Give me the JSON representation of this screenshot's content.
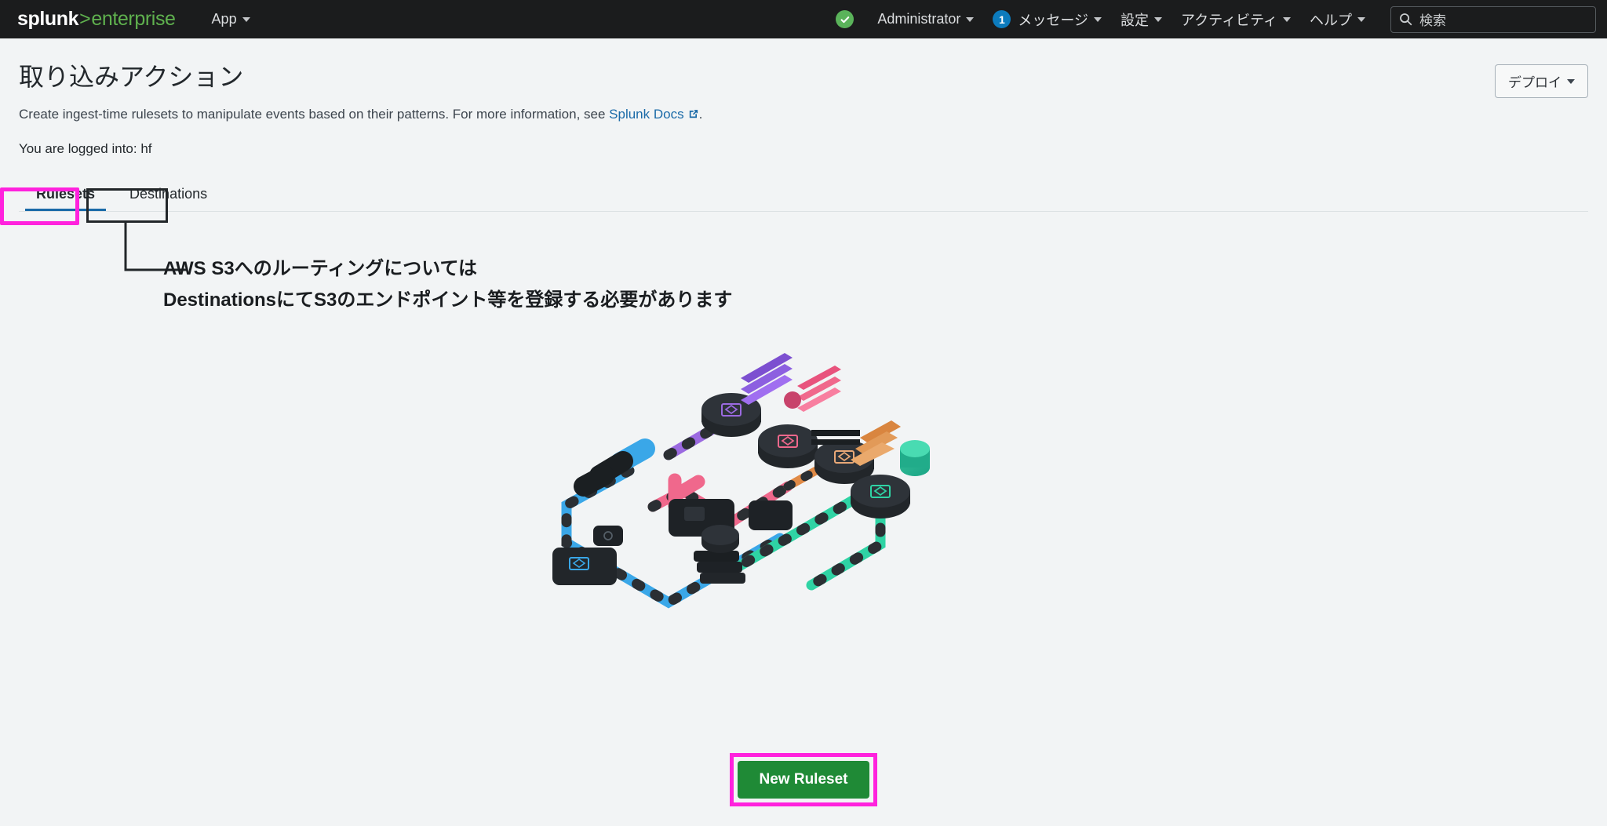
{
  "appbar": {
    "brand": {
      "primary": "splunk",
      "separator": ">",
      "secondary": "enterprise"
    },
    "app_menu": {
      "label": "App",
      "icon": "chevron-down-icon"
    },
    "health_icon": "health-check-ok-icon",
    "account": {
      "label": "Administrator",
      "icon": "chevron-down-icon"
    },
    "messages": {
      "count": "1",
      "label": "メッセージ",
      "icon": "chevron-down-icon"
    },
    "settings": {
      "label": "設定",
      "icon": "chevron-down-icon"
    },
    "activity": {
      "label": "アクティビティ",
      "icon": "chevron-down-icon"
    },
    "help": {
      "label": "ヘルプ",
      "icon": "chevron-down-icon"
    },
    "search": {
      "placeholder": "検索",
      "icon": "search-icon"
    },
    "colors": {
      "background": "#1b1c1d",
      "brand_green": "#5fb14e",
      "badge_blue": "#0c7bbd",
      "health_green": "#5ab35a"
    }
  },
  "page": {
    "title": "取り込みアクション",
    "description_before_link": "Create ingest-time rulesets to manipulate events based on their patterns. For more information, see ",
    "description_link": "Splunk Docs",
    "description_link_icon": "external-link-icon",
    "description_after_link": ".",
    "logged_into": "You are logged into: hf",
    "deploy_button": {
      "label": "デプロイ",
      "icon": "chevron-down-icon"
    }
  },
  "tabs": [
    {
      "label": "Rulesets",
      "active": true
    },
    {
      "label": "Destinations",
      "active": false
    }
  ],
  "annotations": {
    "highlight_color": "#ff22dd",
    "callout_line1": "AWS S3へのルーティングについては",
    "callout_line2": "DestinationsにてS3のエンドポイント等を登録する必要があります"
  },
  "empty_state": {
    "illustration": "isometric-data-pipeline-illustration",
    "new_ruleset_button": {
      "label": "New Ruleset",
      "color": "#1f8a36"
    }
  }
}
